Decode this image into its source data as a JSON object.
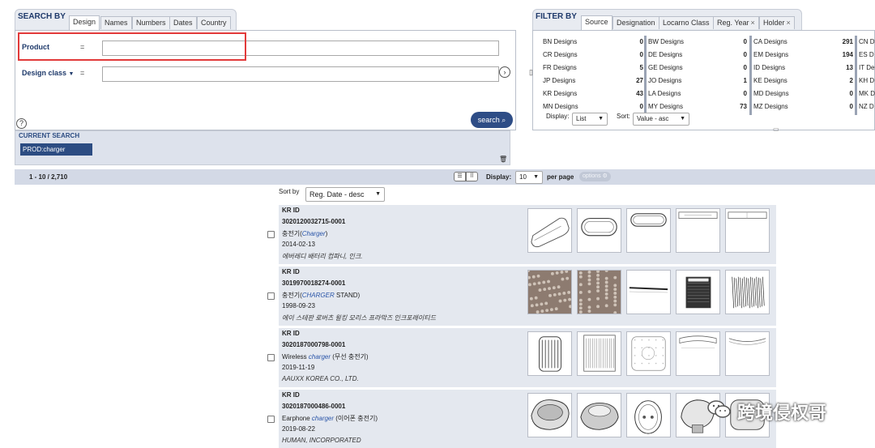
{
  "search_by": {
    "title": "SEARCH BY",
    "tabs": [
      "Design",
      "Names",
      "Numbers",
      "Dates",
      "Country"
    ],
    "product_label": "Product",
    "design_class_label": "Design class",
    "design_class_caret": "▼",
    "eq": "=",
    "product_value": "",
    "design_class_value": "",
    "help": "?",
    "go": "›",
    "search_label": "search ⌕",
    "current_search_label": "CURRENT SEARCH",
    "current_chip": "PROD:charger",
    "trash": "🗑"
  },
  "filter_by": {
    "title": "FILTER BY",
    "tabs": [
      "Source",
      "Designation",
      "Locarno Class",
      "Reg. Year",
      "Holder"
    ],
    "closable_tabs_mark": "×",
    "col1": [
      {
        "name": "BN Designs",
        "count": "0"
      },
      {
        "name": "CR Designs",
        "count": "0"
      },
      {
        "name": "FR Designs",
        "count": "5"
      },
      {
        "name": "JP Designs",
        "count": "27"
      },
      {
        "name": "KR Designs",
        "count": "43"
      },
      {
        "name": "MN Designs",
        "count": "0"
      }
    ],
    "col2": [
      {
        "name": "BW Designs",
        "count": "0"
      },
      {
        "name": "DE Designs",
        "count": "0"
      },
      {
        "name": "GE Designs",
        "count": "0"
      },
      {
        "name": "JO Designs",
        "count": "1"
      },
      {
        "name": "LA Designs",
        "count": "0"
      },
      {
        "name": "MY Designs",
        "count": "73"
      }
    ],
    "col3": [
      {
        "name": "CA Designs",
        "count": "291"
      },
      {
        "name": "EM Designs",
        "count": "194"
      },
      {
        "name": "ID Designs",
        "count": "13"
      },
      {
        "name": "KE Designs",
        "count": "2"
      },
      {
        "name": "MD Designs",
        "count": "0"
      },
      {
        "name": "MZ Designs",
        "count": "0"
      }
    ],
    "col4": [
      "CN D",
      "ES D",
      "IT De",
      "KH D",
      "MK D",
      "NZ D"
    ],
    "display_label": "Display:",
    "display_value": "List",
    "sort_label": "Sort:",
    "sort_value": "Value - asc",
    "expand": "▭",
    "left_toggle": "▯"
  },
  "results": {
    "range": "1 - 10 / 2,710",
    "display_label": "Display:",
    "display_value": "10",
    "per_page": "per page",
    "options_label": "options",
    "sort_by_label": "Sort by",
    "sort_by_value": "Reg. Date - desc",
    "items": [
      {
        "source": "KR ID",
        "number": "3020120032715-0001",
        "title_pre": "충전기(",
        "title_link": "Charger",
        "title_post": ")",
        "date": "2014-02-13",
        "holder": "에버레디 배터리 컴파니, 인크."
      },
      {
        "source": "KR ID",
        "number": "3019970018274-0001",
        "title_pre": "충전기(",
        "title_link": "CHARGER",
        "title_post": " STAND)",
        "date": "1998-09-23",
        "holder": "에이 스테판 로버츠 윌킹 모리스 프라막즈 인크포레이티드"
      },
      {
        "source": "KR ID",
        "number": "3020187000798-0001",
        "title_pre": "Wireless ",
        "title_link": "charger",
        "title_post": " (무선 충전기)",
        "date": "2019-11-19",
        "holder": "AAUXX KOREA CO., LTD."
      },
      {
        "source": "KR ID",
        "number": "3020187000486-0001",
        "title_pre": "Earphone ",
        "title_link": "charger",
        "title_post": " (이어폰 충전기)",
        "date": "2019-08-22",
        "holder": "HUMAN, INCORPORATED"
      }
    ]
  },
  "watermark": "跨境侵权哥"
}
